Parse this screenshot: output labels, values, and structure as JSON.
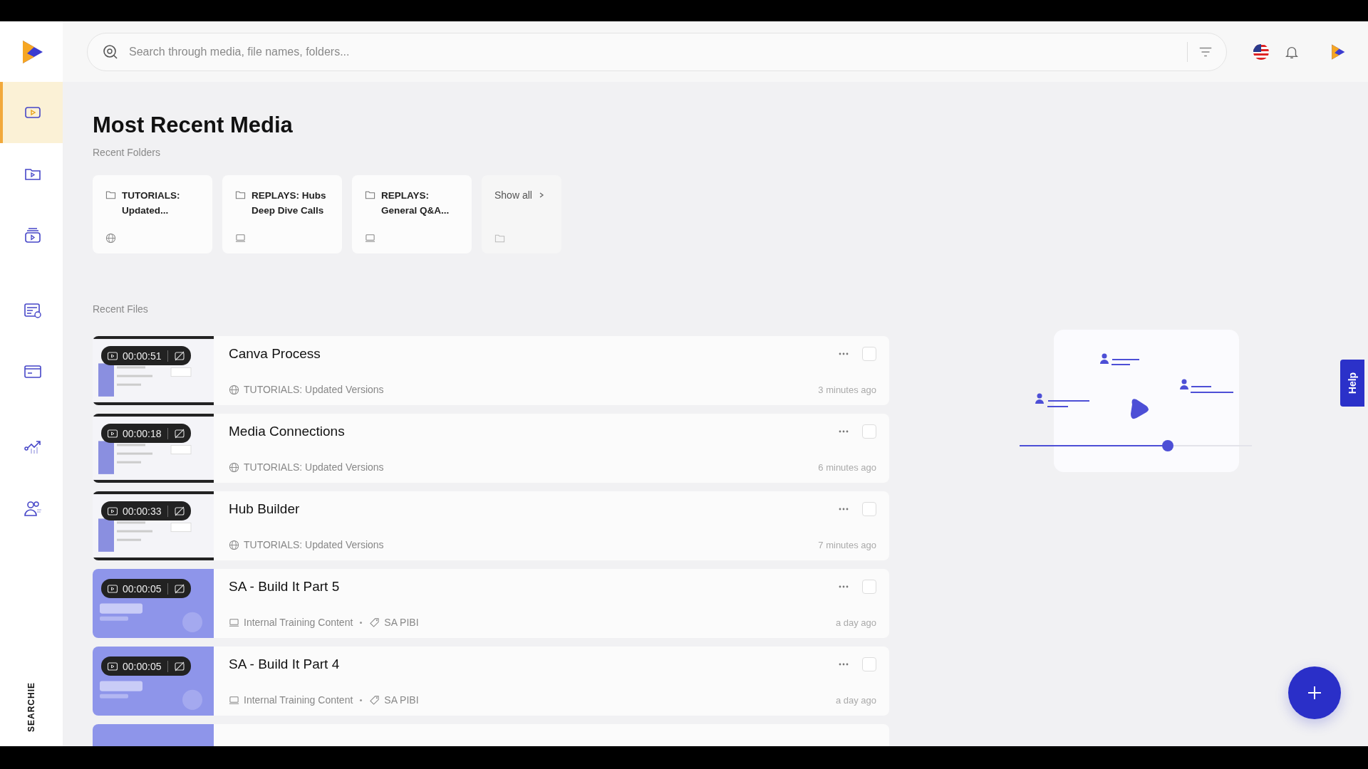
{
  "search": {
    "placeholder": "Search through media, file names, folders..."
  },
  "sidebar": {
    "items": [
      {
        "kind": "media",
        "selected": true
      },
      {
        "kind": "folder",
        "selected": false
      },
      {
        "kind": "stack",
        "selected": false
      },
      {
        "kind": "form",
        "selected": false
      },
      {
        "kind": "browser",
        "selected": false
      },
      {
        "kind": "analytics",
        "selected": false
      },
      {
        "kind": "people",
        "selected": false
      }
    ],
    "brand": "SEARCHIE"
  },
  "page_title": "Most Recent Media",
  "recent_folders": {
    "label": "Recent Folders",
    "folders": [
      {
        "name": "TUTORIALS: Updated...",
        "kind": "public"
      },
      {
        "name": "REPLAYS: Hubs Deep Dive Calls",
        "kind": "internal"
      },
      {
        "name": "REPLAYS: General Q&A...",
        "kind": "internal"
      }
    ],
    "show_all": "Show all"
  },
  "recent_files": {
    "label": "Recent Files",
    "files": [
      {
        "title": "Canva Process",
        "duration": "00:00:51",
        "location": "TUTORIALS: Updated Versions",
        "kind": "public",
        "time": "3 minutes ago",
        "selected": false
      },
      {
        "title": "Media Connections",
        "duration": "00:00:18",
        "location": "TUTORIALS: Updated Versions",
        "kind": "public",
        "time": "6 minutes ago",
        "selected": false
      },
      {
        "title": "Hub Builder",
        "duration": "00:00:33",
        "location": "TUTORIALS: Updated Versions",
        "kind": "public",
        "time": "7 minutes ago",
        "selected": false
      },
      {
        "title": "SA - Build It Part 5",
        "duration": "00:00:05",
        "location": "Internal Training Content",
        "kind": "internal",
        "tag": "SA PIBI",
        "time": "a day ago",
        "selected": false
      },
      {
        "title": "SA - Build It Part 4",
        "duration": "00:00:05",
        "location": "Internal Training Content",
        "kind": "internal",
        "tag": "SA PIBI",
        "time": "a day ago",
        "selected": false
      }
    ]
  },
  "help_tab": "Help"
}
